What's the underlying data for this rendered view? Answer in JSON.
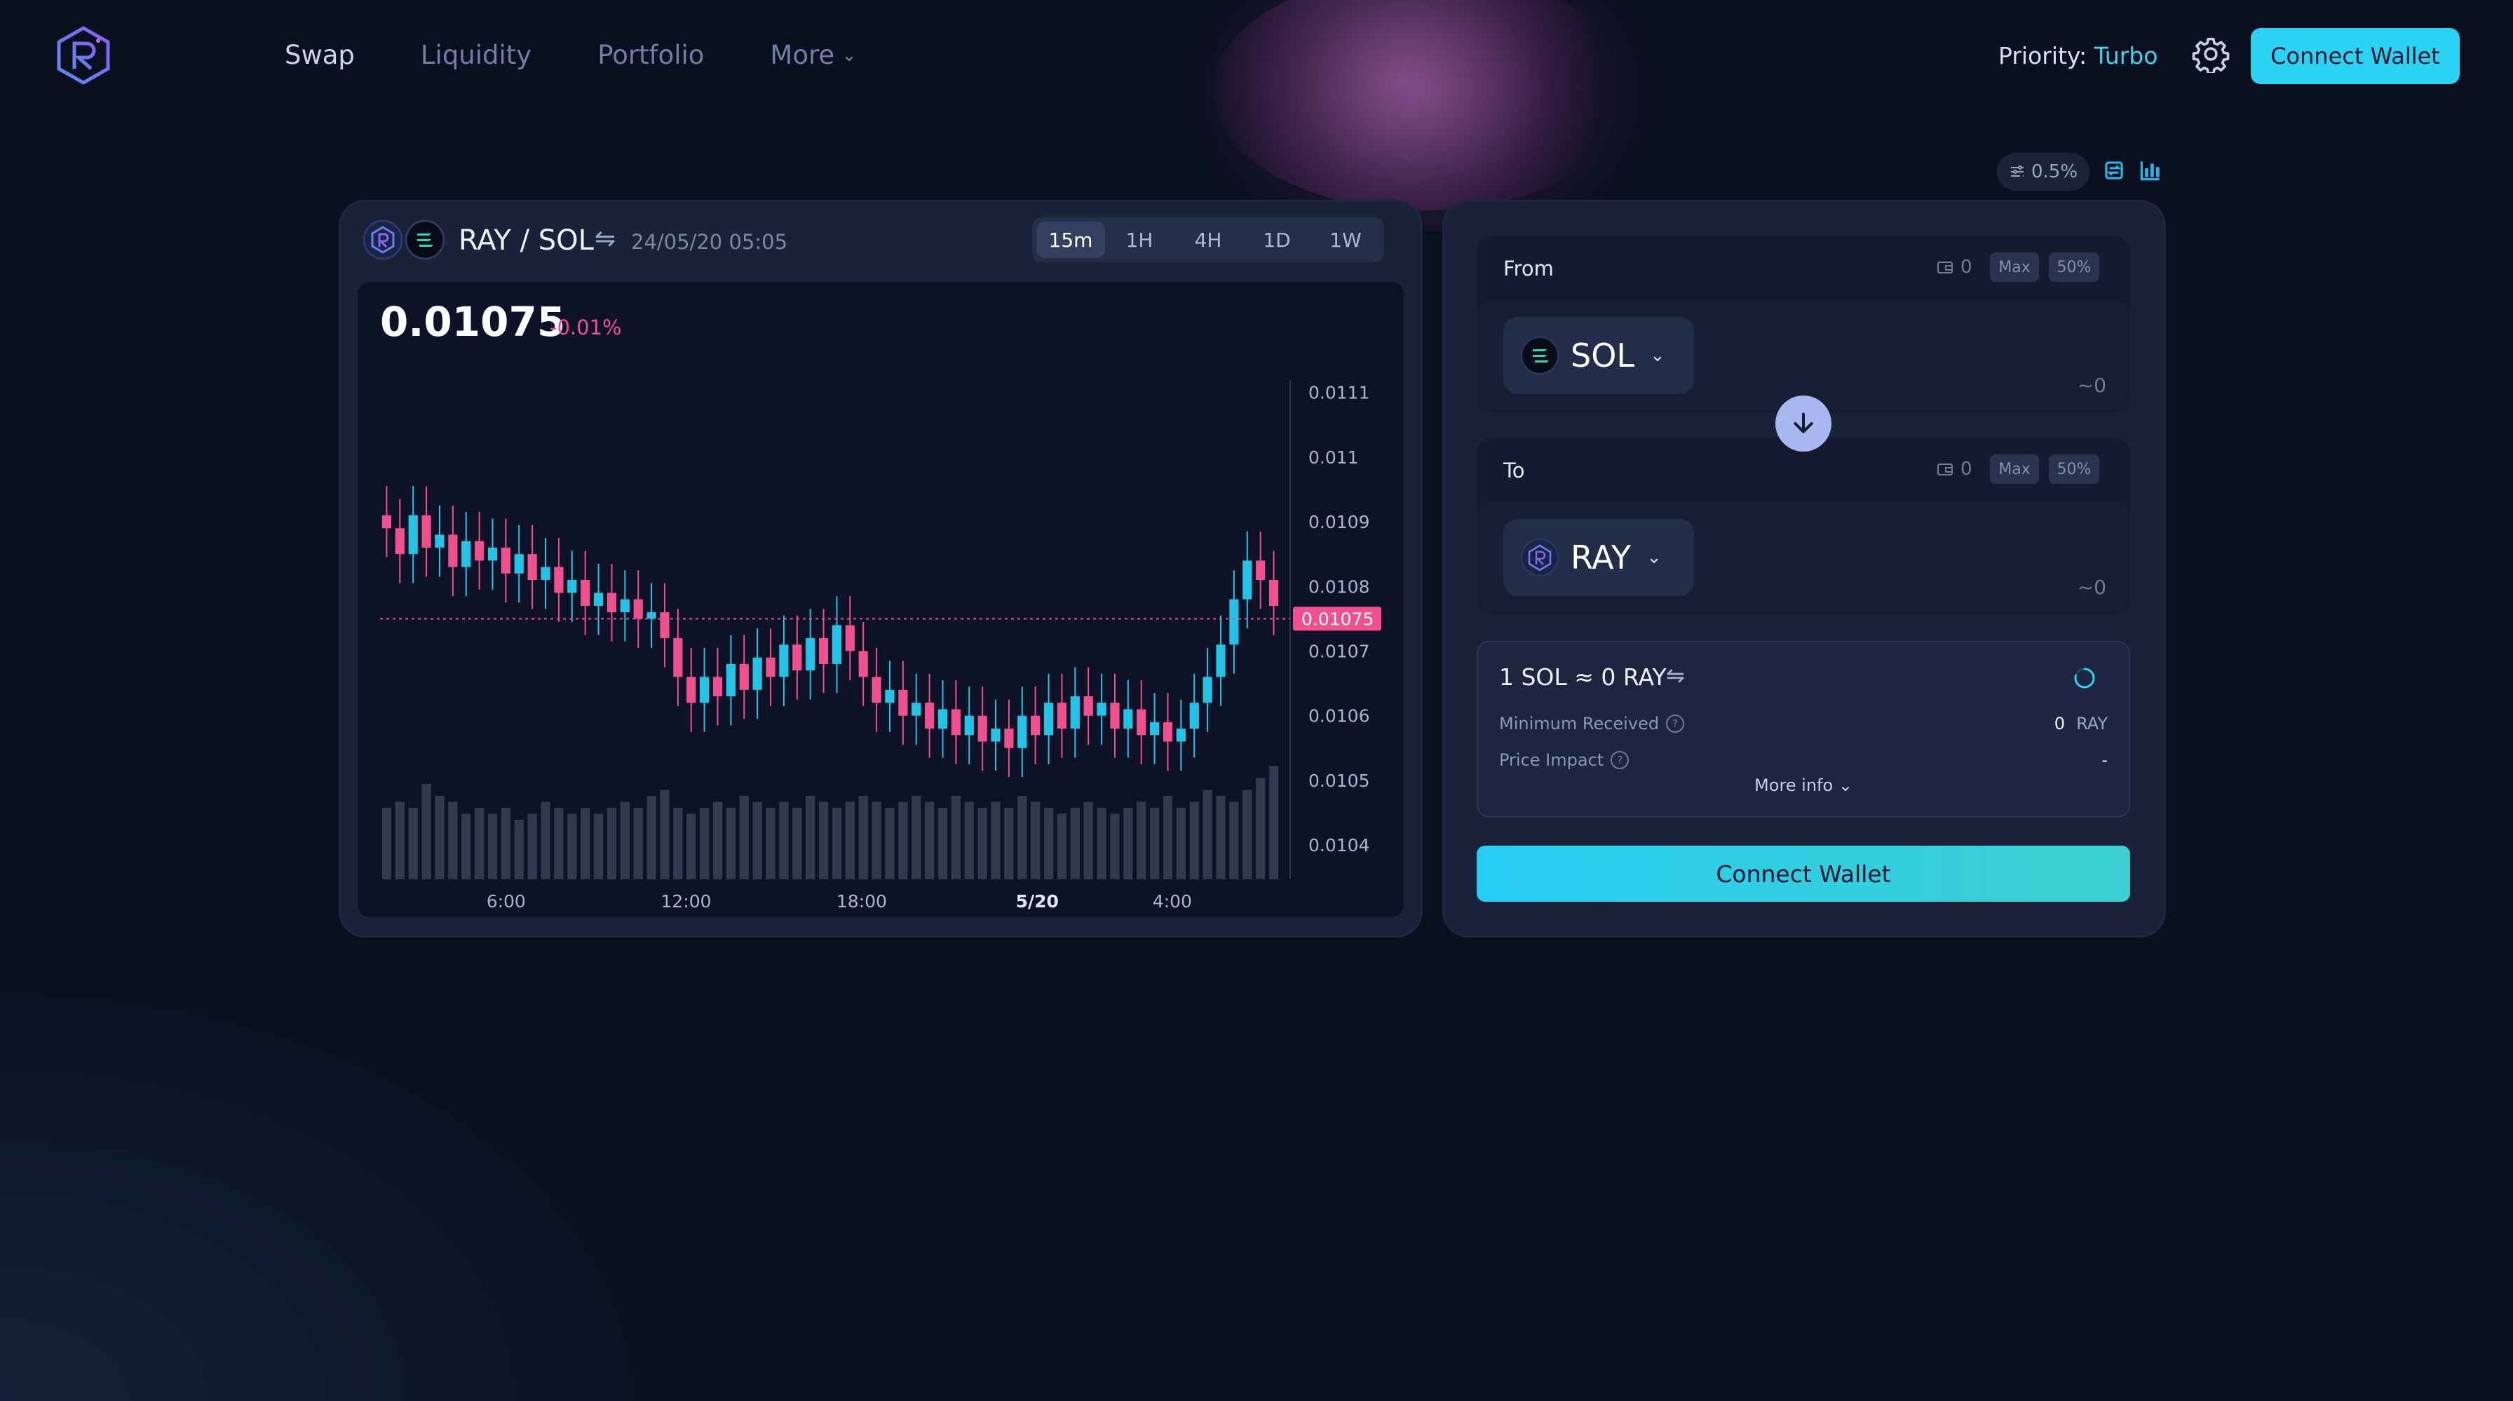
{
  "header": {
    "nav": [
      {
        "label": "Swap",
        "active": true
      },
      {
        "label": "Liquidity",
        "active": false
      },
      {
        "label": "Portfolio",
        "active": false
      },
      {
        "label": "More",
        "active": false
      }
    ],
    "priority_label": "Priority:",
    "priority_value": "Turbo",
    "connect_label": "Connect Wallet"
  },
  "tools": {
    "slippage": "0.5%",
    "icons": [
      "slippage-settings-icon",
      "swap-pair-icon",
      "chart-bars-icon"
    ]
  },
  "chart_panel": {
    "pair": "RAY / SOL",
    "datetime": "24/05/20 05:05",
    "timeframes": [
      "15m",
      "1H",
      "4H",
      "1D",
      "1W"
    ],
    "active_timeframe": "15m",
    "price": "0.01075",
    "change": "-0.01%",
    "current_price_label": "0.01075",
    "colors": {
      "up": "#22c3e6",
      "down": "#f0508e",
      "volume": "#3a4258"
    }
  },
  "chart_data": {
    "type": "candlestick",
    "title": "RAY / SOL",
    "x_ticks": [
      "6:00",
      "12:00",
      "18:00",
      "5/20",
      "4:00"
    ],
    "y_ticks": [
      "0.0111",
      "0.011",
      "0.0109",
      "0.0108",
      "0.0107",
      "0.0106",
      "0.0105",
      "0.0104"
    ],
    "ylim": [
      0.01036,
      0.01113
    ],
    "current_price": 0.01075,
    "closes": [
      0.01089,
      0.01085,
      0.01091,
      0.01086,
      0.01088,
      0.01083,
      0.01087,
      0.01084,
      0.01086,
      0.01082,
      0.01085,
      0.01081,
      0.01083,
      0.01079,
      0.01081,
      0.01077,
      0.01079,
      0.01076,
      0.01078,
      0.01075,
      0.01076,
      0.01072,
      0.01066,
      0.01062,
      0.01066,
      0.01063,
      0.01068,
      0.01064,
      0.01069,
      0.01066,
      0.01071,
      0.01067,
      0.01072,
      0.01068,
      0.01074,
      0.0107,
      0.01066,
      0.01062,
      0.01064,
      0.0106,
      0.01062,
      0.01058,
      0.01061,
      0.01057,
      0.0106,
      0.01056,
      0.01058,
      0.01055,
      0.0106,
      0.01057,
      0.01062,
      0.01058,
      0.01063,
      0.0106,
      0.01062,
      0.01058,
      0.01061,
      0.01057,
      0.01059,
      0.01056,
      0.01058,
      0.01062,
      0.01066,
      0.01071,
      0.01078,
      0.01084,
      0.01081,
      0.01077
    ],
    "volumes": [
      0.012,
      0.013,
      0.012,
      0.016,
      0.014,
      0.013,
      0.011,
      0.012,
      0.011,
      0.012,
      0.01,
      0.011,
      0.013,
      0.012,
      0.011,
      0.012,
      0.011,
      0.012,
      0.013,
      0.012,
      0.014,
      0.015,
      0.012,
      0.011,
      0.012,
      0.013,
      0.012,
      0.014,
      0.013,
      0.012,
      0.013,
      0.012,
      0.014,
      0.013,
      0.012,
      0.013,
      0.014,
      0.013,
      0.012,
      0.013,
      0.014,
      0.013,
      0.012,
      0.014,
      0.013,
      0.012,
      0.013,
      0.012,
      0.014,
      0.013,
      0.012,
      0.011,
      0.012,
      0.013,
      0.012,
      0.011,
      0.012,
      0.013,
      0.012,
      0.014,
      0.012,
      0.013,
      0.015,
      0.014,
      0.013,
      0.015,
      0.017,
      0.019
    ]
  },
  "swap_panel": {
    "from": {
      "label": "From",
      "balance": "0",
      "max": "Max",
      "half": "50%",
      "token": "SOL",
      "approx": "~0"
    },
    "to": {
      "label": "To",
      "balance": "0",
      "max": "Max",
      "half": "50%",
      "token": "RAY",
      "approx": "~0"
    },
    "rate": "1 SOL ≈ 0 RAY",
    "min_received_label": "Minimum Received",
    "min_received_value": "0",
    "min_received_unit": "RAY",
    "price_impact_label": "Price Impact",
    "price_impact_value": "-",
    "more_info": "More info",
    "connect_label": "Connect Wallet"
  }
}
